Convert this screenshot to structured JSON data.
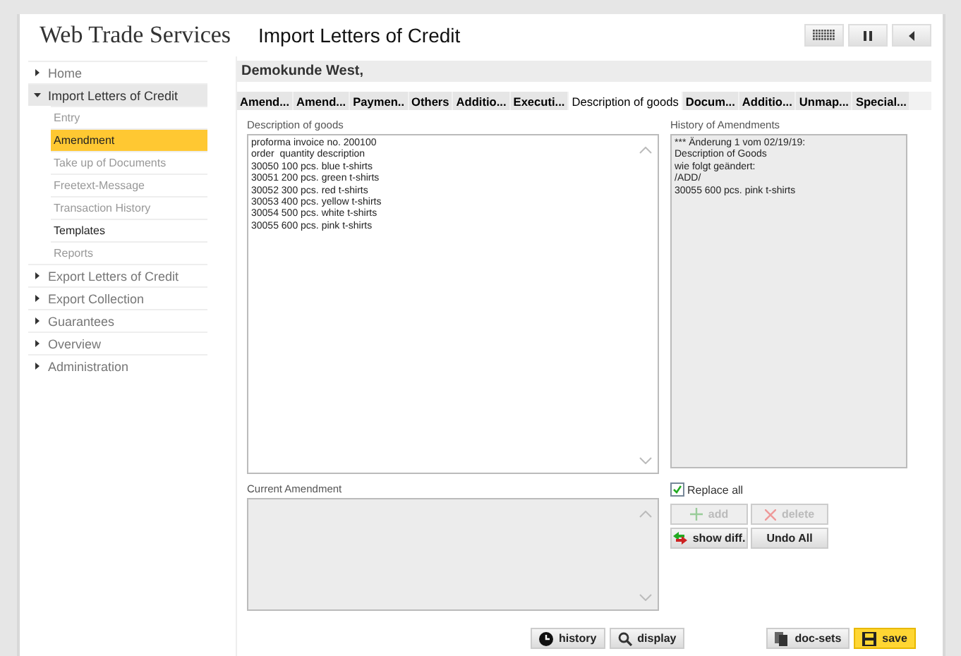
{
  "app_title": "Web Trade Services",
  "page_title": "Import Letters of Credit",
  "toolbar": [
    {
      "kind": "grid"
    },
    {
      "kind": "pause"
    },
    {
      "kind": "back"
    }
  ],
  "sidebar": [
    {
      "label": "Home",
      "expanded": false
    },
    {
      "label": "Import Letters of Credit",
      "expanded": true,
      "children": [
        {
          "label": "Entry",
          "selected": false,
          "disabled": true
        },
        {
          "label": "Amendment",
          "selected": true,
          "disabled": false
        },
        {
          "label": "Take up of Documents",
          "selected": false,
          "disabled": true
        },
        {
          "label": "Freetext-Message",
          "selected": false,
          "disabled": true
        },
        {
          "label": "Transaction History",
          "selected": false,
          "disabled": true
        },
        {
          "label": "Templates",
          "selected": false,
          "disabled": false
        },
        {
          "label": "Reports",
          "selected": false,
          "disabled": true
        }
      ]
    },
    {
      "label": "Export Letters of Credit",
      "expanded": false
    },
    {
      "label": "Export Collection",
      "expanded": false
    },
    {
      "label": "Guarantees",
      "expanded": false
    },
    {
      "label": "Overview",
      "expanded": false
    },
    {
      "label": "Administration",
      "expanded": false
    }
  ],
  "customer": "Demokunde West,",
  "tabs": [
    {
      "label": "Amend...",
      "selected": false
    },
    {
      "label": "Amend...",
      "selected": false
    },
    {
      "label": "Paymen..",
      "selected": false
    },
    {
      "label": "Others",
      "selected": false
    },
    {
      "label": "Additio...",
      "selected": false
    },
    {
      "label": "Executi...",
      "selected": false
    },
    {
      "label": "Description of goods",
      "selected": true
    },
    {
      "label": "Docum...",
      "selected": false
    },
    {
      "label": "Additio...",
      "selected": false
    },
    {
      "label": "Unmap...",
      "selected": false
    },
    {
      "label": "Special...",
      "selected": false
    }
  ],
  "description": {
    "label": "Description of goods",
    "value": "proforma invoice no. 200100\norder  quantity description\n30050 100 pcs. blue t-shirts\n30051 200 pcs. green t-shirts\n30052 300 pcs. red t-shirts\n30053 400 pcs. yellow t-shirts\n30054 500 pcs. white t-shirts\n30055 600 pcs. pink t-shirts"
  },
  "history": {
    "label": "History of Amendments",
    "value": "*** Änderung 1 vom 02/19/19:\nDescription of Goods\nwie folgt geändert:\n/ADD/\n30055 600 pcs. pink t-shirts"
  },
  "current": {
    "label": "Current Amendment",
    "disabled": true
  },
  "replace_all": {
    "label": "Replace all",
    "checked": true
  },
  "edit_buttons": [
    {
      "label": "add",
      "kind": "plus",
      "disabled": true
    },
    {
      "label": "delete",
      "kind": "x",
      "disabled": true
    },
    {
      "label": "show diff.",
      "kind": "diff",
      "disabled": false
    },
    {
      "label": "Undo All",
      "kind": "text",
      "disabled": false
    }
  ],
  "footer_buttons": [
    {
      "label": "history",
      "kind": "clock",
      "primary": false
    },
    {
      "label": "display",
      "kind": "search",
      "primary": false
    },
    {
      "label": "doc-sets",
      "kind": "docs",
      "primary": false
    },
    {
      "label": "save",
      "kind": "disk",
      "primary": true
    }
  ]
}
